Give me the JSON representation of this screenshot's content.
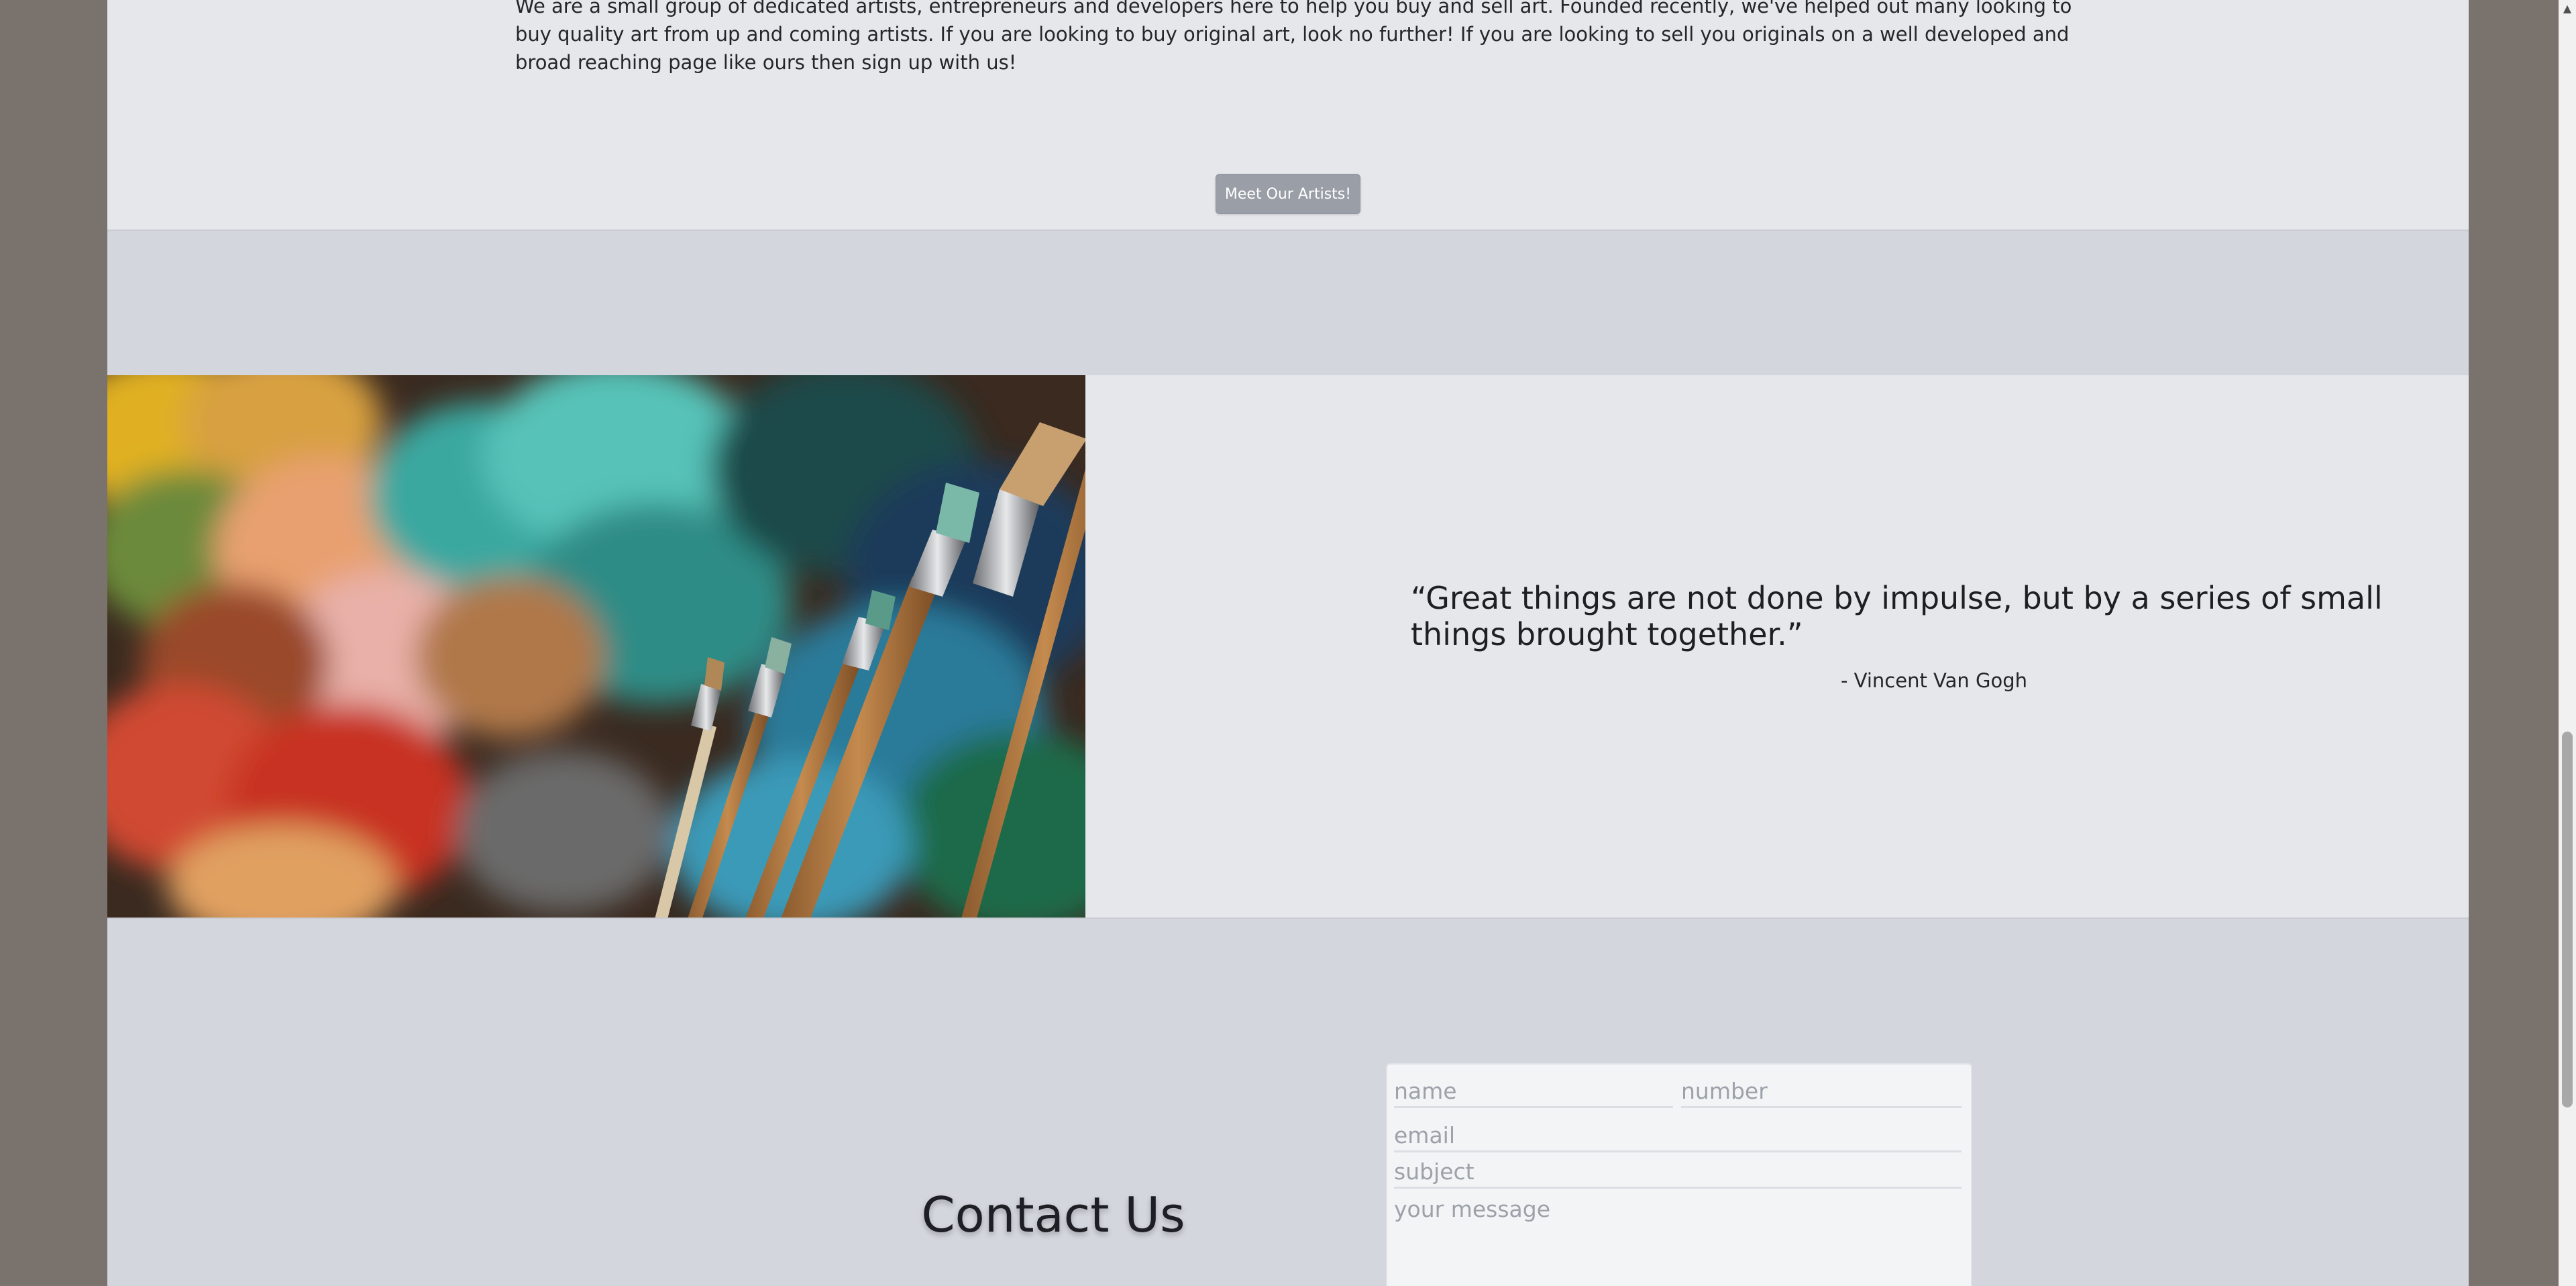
{
  "about": {
    "paragraph": "We are a small group of dedicated artists, entrepreneurs and developers here to help you buy and sell art. Founded recently, we've helped out many looking to buy quality art from up and coming artists. If you are looking to buy original art, look no further! If you are looking to sell you originals on a well developed and broad reaching page like ours then sign up with us!",
    "button_label": "Meet Our Artists!"
  },
  "quote": {
    "text": "“Great things are not done by impulse, but by a series of small things brought together.”",
    "author": "- Vincent Van Gogh"
  },
  "contact": {
    "title": "Contact Us",
    "name_placeholder": "name",
    "number_placeholder": "number",
    "email_placeholder": "email",
    "subject_placeholder": "subject",
    "message_placeholder": "your message"
  },
  "scrollbar": {
    "up_arrow": "▲"
  }
}
